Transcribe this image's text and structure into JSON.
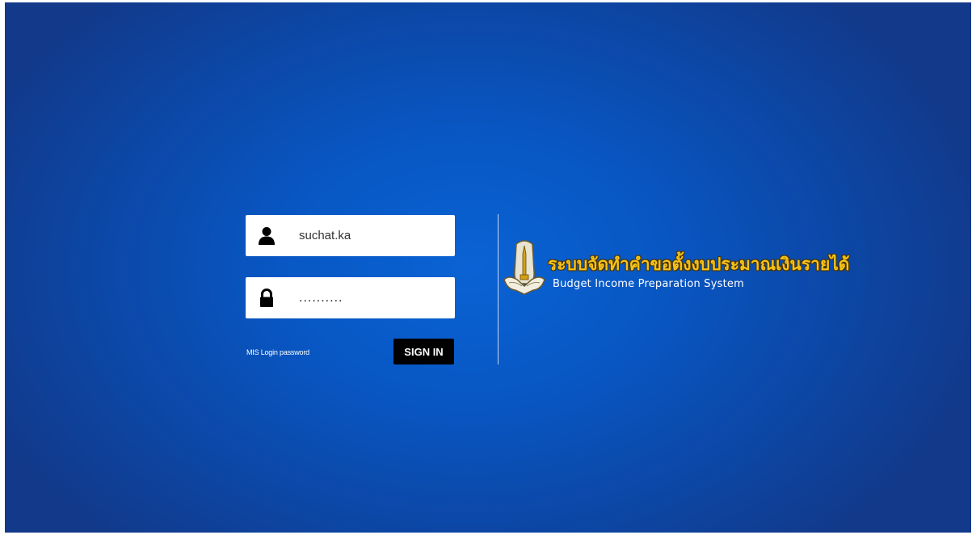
{
  "login": {
    "username": {
      "value": "suchat.ka",
      "icon": "user-icon"
    },
    "password": {
      "value": "..........",
      "icon": "lock-icon"
    },
    "mis_link_label": "MIS Login password",
    "signin_label": "SIGN IN"
  },
  "brand": {
    "title_thai": "ระบบจัดทำคำขอตั้งงบประมาณเงินรายได้",
    "title_english": "Budget Income Preparation System",
    "logo_icon": "university-seal-icon"
  },
  "colors": {
    "background": "#0a5fd0",
    "title_thai": "#f4c21a",
    "button": "#000000"
  }
}
